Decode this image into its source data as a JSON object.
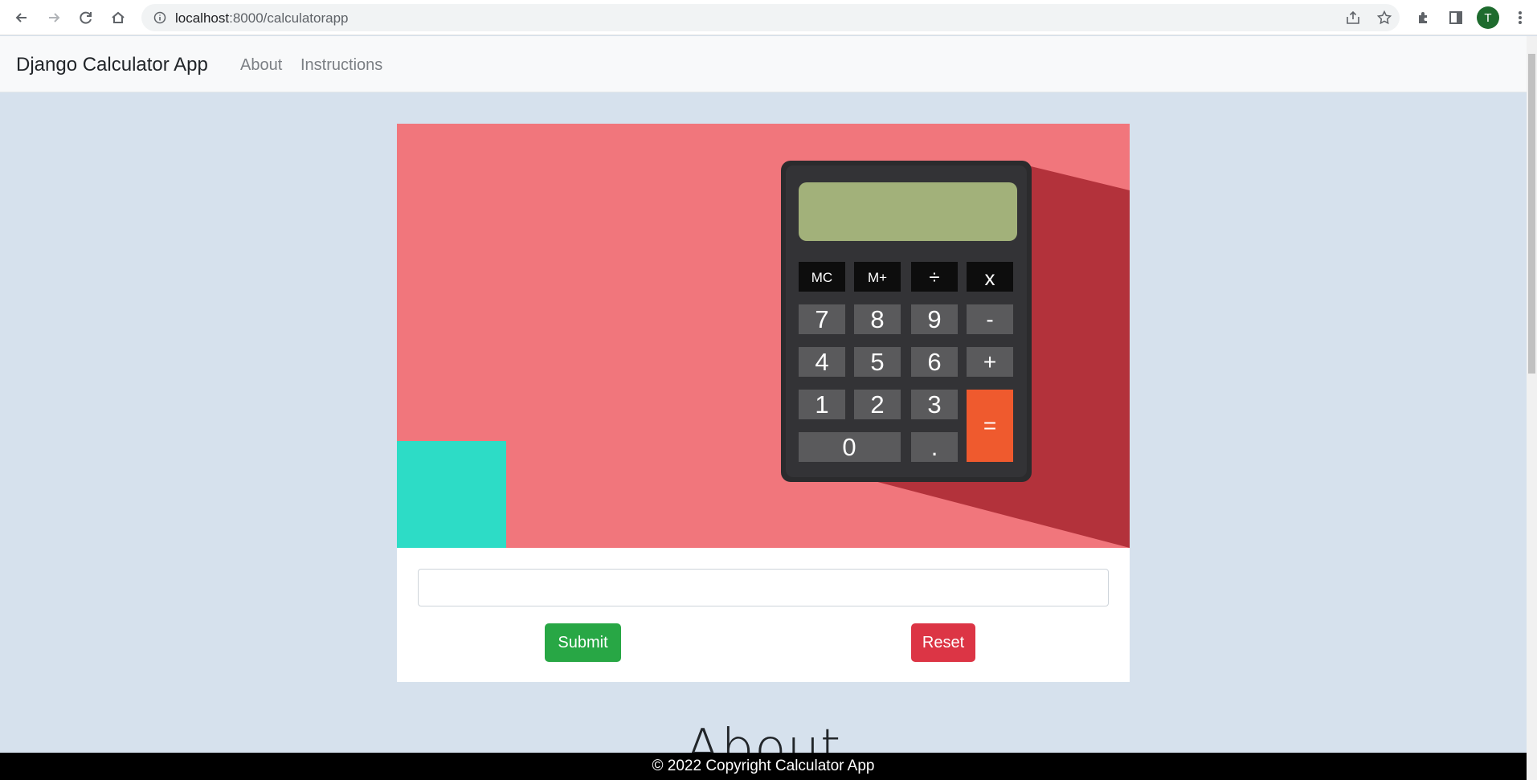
{
  "browser": {
    "url_host": "localhost",
    "url_path": ":8000/calculatorapp",
    "profile_initial": "T"
  },
  "navbar": {
    "brand": "Django Calculator App",
    "links": [
      "About",
      "Instructions"
    ]
  },
  "hero": {
    "calculator_keys": {
      "row1": [
        "MC",
        "M+",
        "÷",
        "x"
      ],
      "row2": [
        "7",
        "8",
        "9",
        "-"
      ],
      "row3": [
        "4",
        "5",
        "6",
        "+"
      ],
      "row4": [
        "1",
        "2",
        "3"
      ],
      "row5": [
        "0",
        "."
      ],
      "equals": "="
    }
  },
  "form": {
    "input_value": "",
    "submit_label": "Submit",
    "reset_label": "Reset"
  },
  "sections": {
    "about_heading": "About"
  },
  "footer": {
    "text": "© 2022 Copyright Calculator App"
  },
  "colors": {
    "page_bg": "#d6e1ed",
    "hero_bg": "#f1767c",
    "hero_shadow": "#b3323b",
    "teal_block": "#2ddcc6",
    "calc_body": "#2b2b2d",
    "calc_screen": "#a2b17a",
    "equals_key": "#ef5a2e",
    "submit": "#28a745",
    "reset": "#dc3545"
  }
}
